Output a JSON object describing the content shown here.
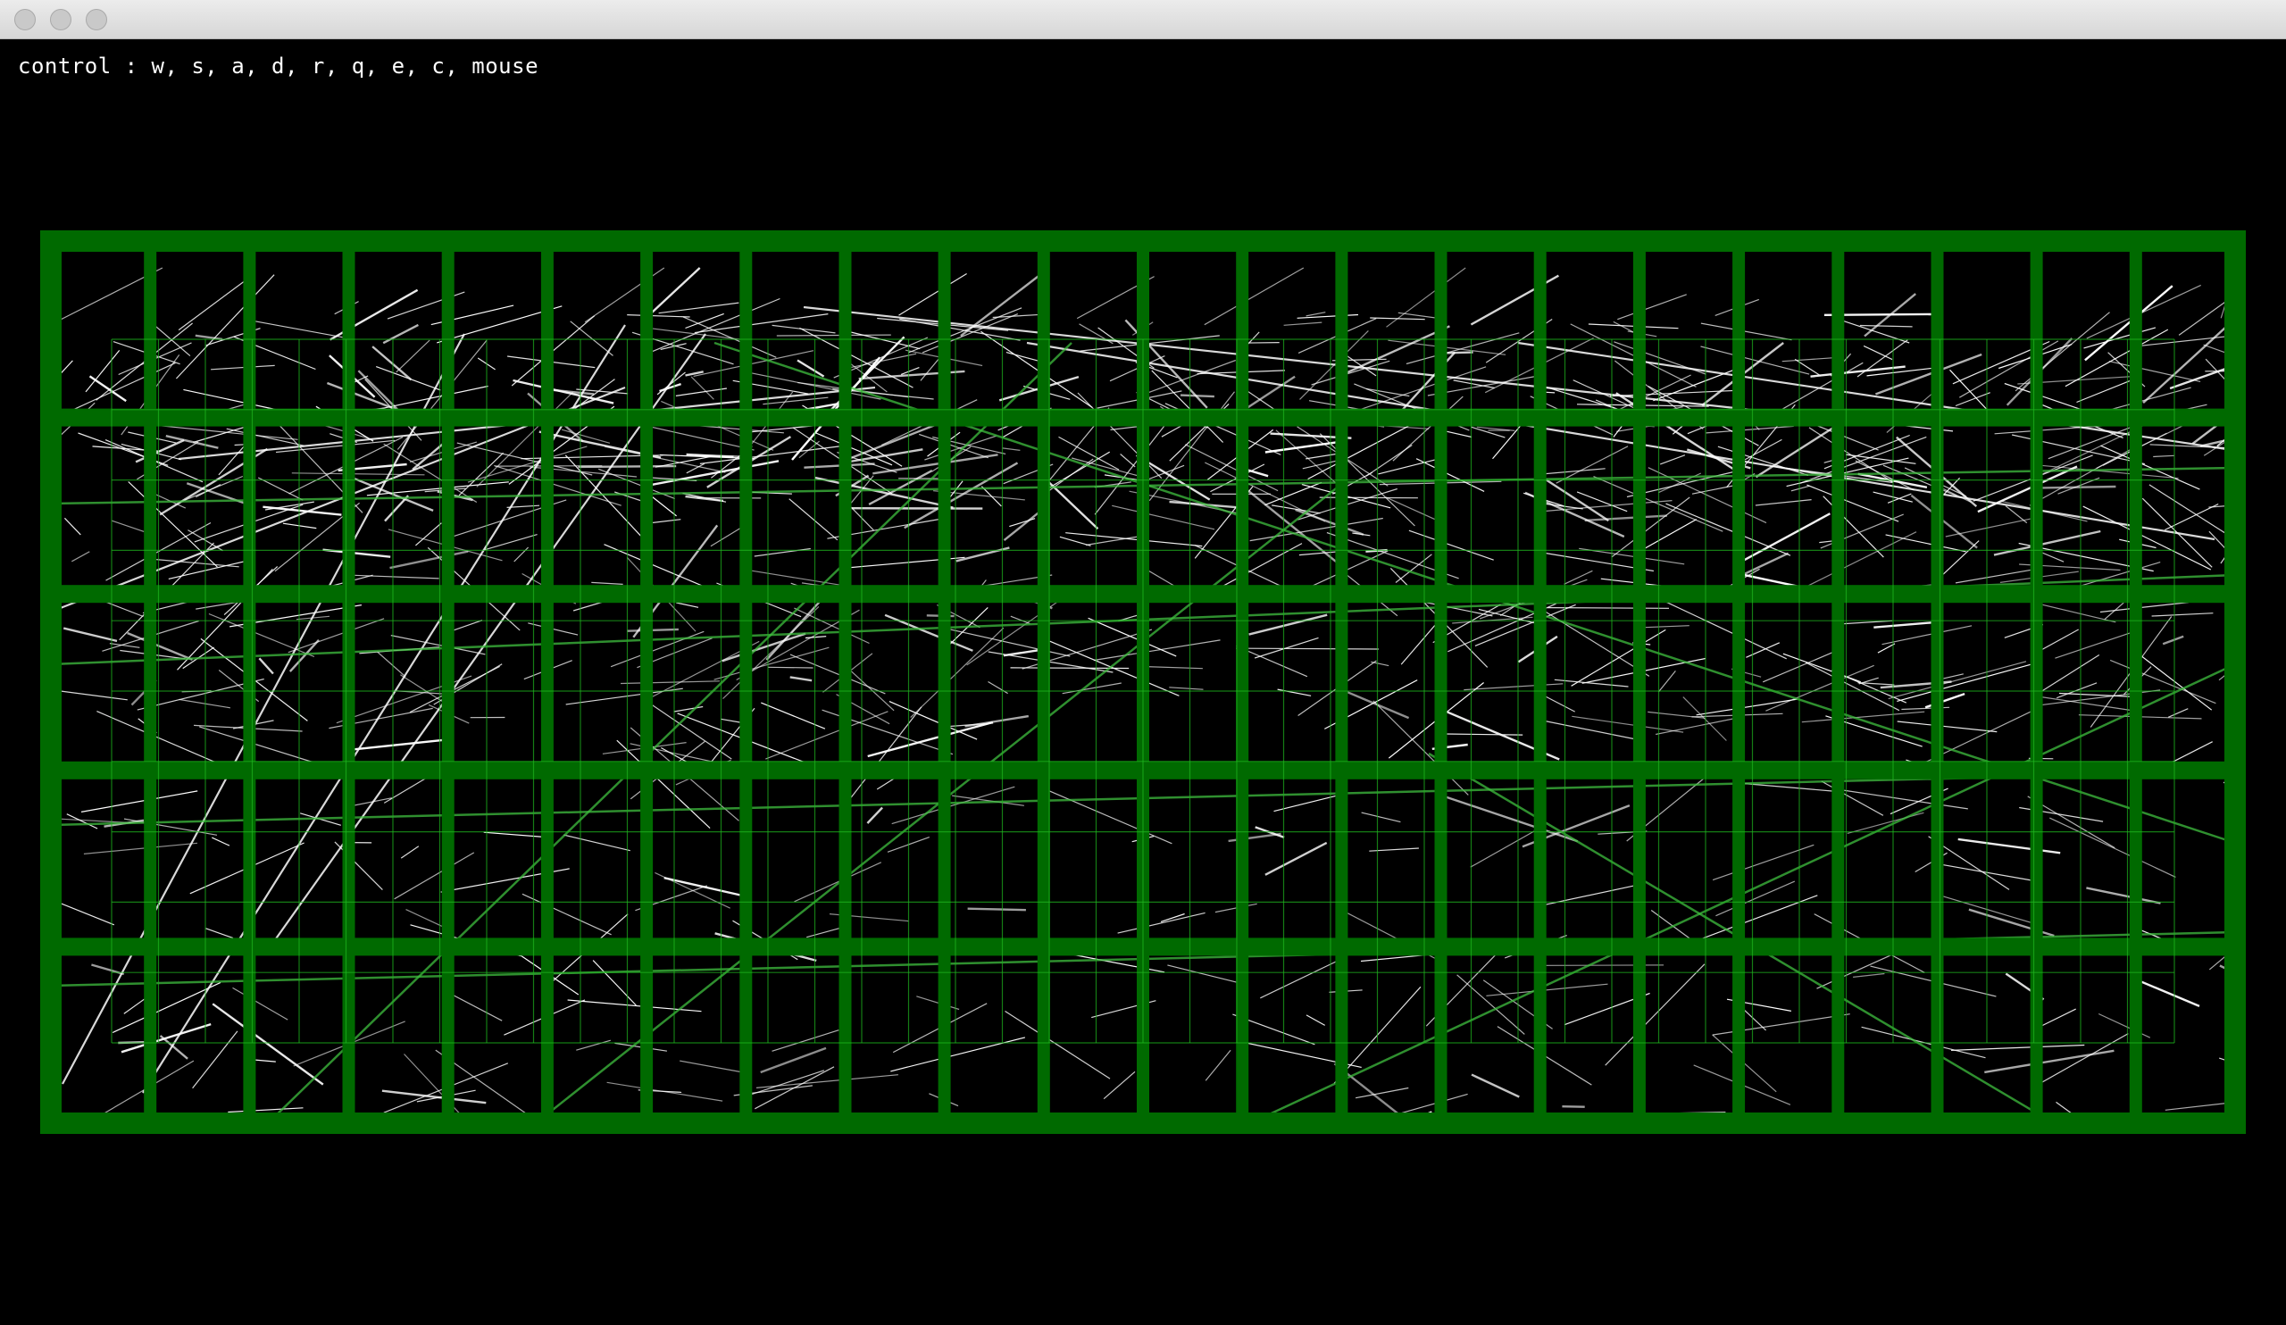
{
  "window": {
    "buttons": [
      "close",
      "minimize",
      "zoom"
    ]
  },
  "hud": {
    "controls_text": "control : w, s, a, d, r, q, e, c, mouse"
  },
  "viewport": {
    "grid_color": "#006a00",
    "thin_grid_color": "#1fb31f",
    "map_line_color": "#ffffff",
    "route_color": "#3fbf3f",
    "grid_columns": 22,
    "grid_rows": 5
  }
}
